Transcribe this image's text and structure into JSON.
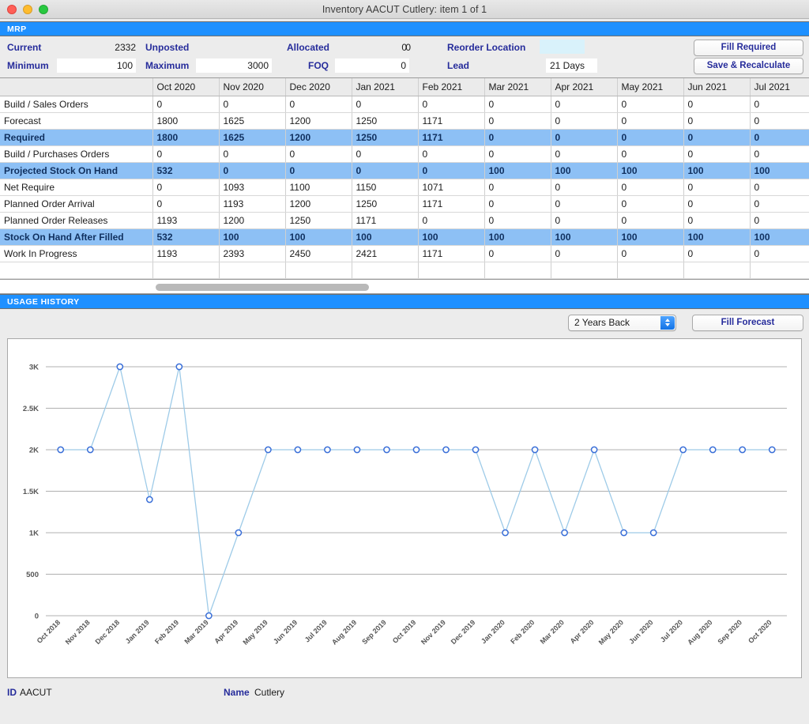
{
  "window": {
    "title": "Inventory AACUT Cutlery: item 1  of  1",
    "traffic_lights": [
      "close",
      "minimize",
      "zoom"
    ]
  },
  "mrp": {
    "section_title": "MRP",
    "fields": [
      {
        "label": "Current",
        "value": "2332",
        "editable": false
      },
      {
        "label": "Unposted",
        "value": "0",
        "editable": false
      },
      {
        "label": "Allocated",
        "value": "0",
        "editable": false
      },
      {
        "label": "Reorder Location",
        "value": "",
        "editable": true
      },
      {
        "label": "Minimum",
        "value": "100",
        "editable": true
      },
      {
        "label": "Maximum",
        "value": "3000",
        "editable": true
      },
      {
        "label": "FOQ",
        "value": "0",
        "editable": true
      },
      {
        "label": "Lead",
        "value": "21 Days",
        "editable": true
      }
    ],
    "buttons": [
      {
        "label": "Fill Required"
      },
      {
        "label": "Save & Recalculate"
      }
    ],
    "table": {
      "row_header_label": "",
      "columns": [
        "Oct 2020",
        "Nov 2020",
        "Dec 2020",
        "Jan 2021",
        "Feb 2021",
        "Mar 2021",
        "Apr 2021",
        "May 2021",
        "Jun 2021",
        "Jul 2021"
      ],
      "rows": [
        {
          "label": "Build / Sales Orders",
          "highlight": false,
          "values": [
            "0",
            "0",
            "0",
            "0",
            "0",
            "0",
            "0",
            "0",
            "0",
            "0"
          ]
        },
        {
          "label": "Forecast",
          "highlight": false,
          "values": [
            "1800",
            "1625",
            "1200",
            "1250",
            "1171",
            "0",
            "0",
            "0",
            "0",
            "0"
          ]
        },
        {
          "label": "Required",
          "highlight": true,
          "values": [
            "1800",
            "1625",
            "1200",
            "1250",
            "1171",
            "0",
            "0",
            "0",
            "0",
            "0"
          ]
        },
        {
          "label": "Build / Purchases Orders",
          "highlight": false,
          "values": [
            "0",
            "0",
            "0",
            "0",
            "0",
            "0",
            "0",
            "0",
            "0",
            "0"
          ]
        },
        {
          "label": "Projected Stock On Hand",
          "highlight": true,
          "values": [
            "532",
            "0",
            "0",
            "0",
            "0",
            "100",
            "100",
            "100",
            "100",
            "100"
          ]
        },
        {
          "label": "Net Require",
          "highlight": false,
          "values": [
            "0",
            "1093",
            "1100",
            "1150",
            "1071",
            "0",
            "0",
            "0",
            "0",
            "0"
          ]
        },
        {
          "label": "Planned Order Arrival",
          "highlight": false,
          "values": [
            "0",
            "1193",
            "1200",
            "1250",
            "1171",
            "0",
            "0",
            "0",
            "0",
            "0"
          ]
        },
        {
          "label": "Planned Order Releases",
          "highlight": false,
          "values": [
            "1193",
            "1200",
            "1250",
            "1171",
            "0",
            "0",
            "0",
            "0",
            "0",
            "0"
          ]
        },
        {
          "label": "Stock On Hand After Filled",
          "highlight": true,
          "values": [
            "532",
            "100",
            "100",
            "100",
            "100",
            "100",
            "100",
            "100",
            "100",
            "100"
          ]
        },
        {
          "label": "Work In Progress",
          "highlight": false,
          "values": [
            "1193",
            "2393",
            "2450",
            "2421",
            "1171",
            "0",
            "0",
            "0",
            "0",
            "0"
          ]
        }
      ]
    }
  },
  "usage": {
    "section_title": "USAGE HISTORY",
    "range_select": {
      "value": "2 Years Back"
    },
    "fill_forecast_button": "Fill Forecast"
  },
  "footer": {
    "id_label": "ID",
    "id_value": "AACUT",
    "name_label": "Name",
    "name_value": "Cutlery"
  },
  "chart_data": {
    "type": "line",
    "title": "",
    "xlabel": "",
    "ylabel": "",
    "ylim": [
      0,
      3200
    ],
    "yticks": [
      0,
      500,
      1000,
      1500,
      2000,
      2500,
      3000
    ],
    "ytick_labels": [
      "0",
      "500",
      "1K",
      "1.5K",
      "2K",
      "2.5K",
      "3K"
    ],
    "grid": true,
    "legend": "none",
    "marker": "open-circle",
    "line_color": "#9ecbe8",
    "marker_color": "#3a6fd8",
    "categories": [
      "Oct 2018",
      "Nov 2018",
      "Dec 2018",
      "Jan 2019",
      "Feb 2019",
      "Mar 2019",
      "Apr 2019",
      "May 2019",
      "Jun 2019",
      "Jul 2019",
      "Aug 2019",
      "Sep 2019",
      "Oct 2019",
      "Nov 2019",
      "Dec 2019",
      "Jan 2020",
      "Feb 2020",
      "Mar 2020",
      "Apr 2020",
      "May 2020",
      "Jun 2020",
      "Jul 2020",
      "Aug 2020",
      "Sep 2020",
      "Oct 2020"
    ],
    "values": [
      2000,
      2000,
      3000,
      1400,
      3000,
      0,
      1000,
      2000,
      2000,
      2000,
      2000,
      2000,
      2000,
      2000,
      2000,
      1000,
      2000,
      1000,
      2000,
      1000,
      1000,
      2000,
      2000,
      2000,
      2000
    ]
  }
}
